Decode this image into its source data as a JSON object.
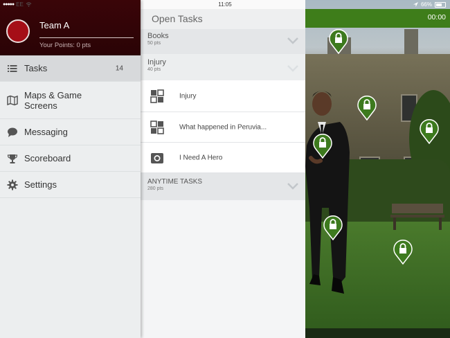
{
  "status_bar": {
    "carrier": "EE",
    "time": "11:05",
    "battery": "66%",
    "battery_level": 0.66
  },
  "sidebar": {
    "team_name": "Team A",
    "points": "Your Points: 0 pts",
    "items": [
      {
        "label": "Tasks",
        "icon": "list-icon",
        "badge": "14",
        "active": true
      },
      {
        "label": "Maps & Game Screens",
        "icon": "map-icon"
      },
      {
        "label": "Messaging",
        "icon": "chat-icon"
      },
      {
        "label": "Scoreboard",
        "icon": "trophy-icon"
      },
      {
        "label": "Settings",
        "icon": "gear-icon"
      }
    ]
  },
  "tasks_panel": {
    "title": "Open Tasks",
    "sections": [
      {
        "title": "Books",
        "pts": "50 pts"
      },
      {
        "title": "Injury",
        "pts": "40 pts"
      }
    ],
    "rows": [
      {
        "label": "Injury",
        "icon": "grid-icon"
      },
      {
        "label": "What happened in Peruvia...",
        "icon": "grid-icon"
      },
      {
        "label": "I Need A Hero",
        "icon": "camera-icon"
      }
    ],
    "anytime": {
      "title": "ANYTIME TASKS",
      "pts": "280 pts"
    }
  },
  "map": {
    "timer": "00:00",
    "accent_color": "#3e7d1a",
    "pin_icon": "lock-pin-icon"
  },
  "colors": {
    "profile_bg": "#3a0508",
    "avatar": "#a50e17",
    "green": "#3e7d1a"
  }
}
